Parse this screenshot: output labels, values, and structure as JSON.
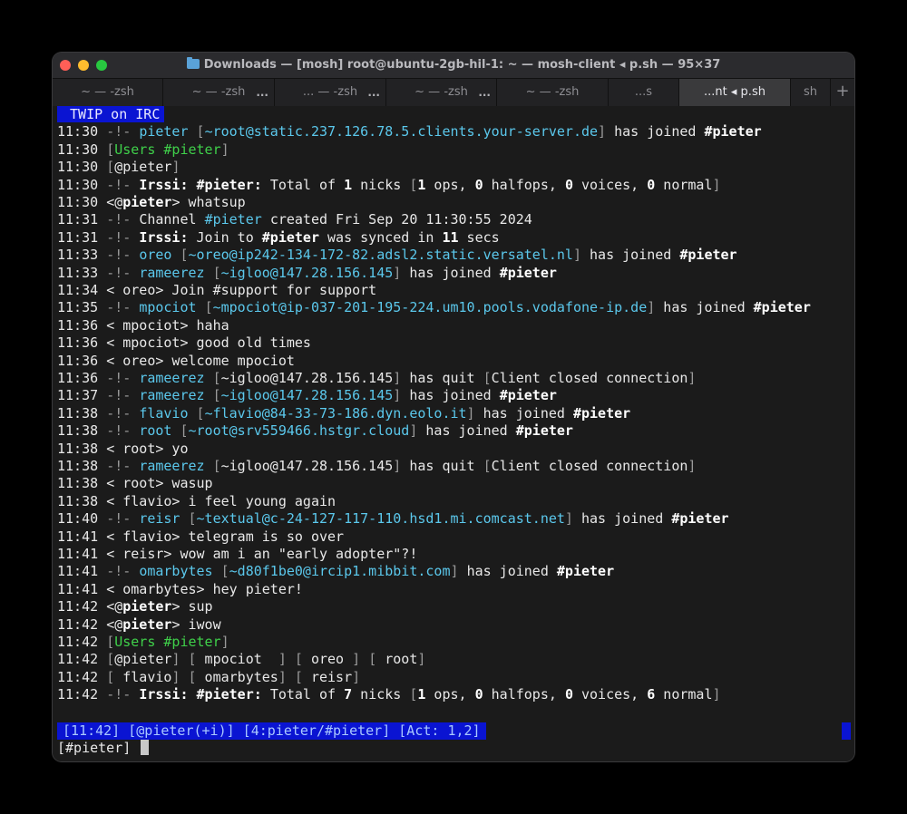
{
  "window": {
    "title": "Downloads — [mosh] root@ubuntu-2gb-hil-1: ~ — mosh-client ◂ p.sh — 95×37",
    "tabs": [
      {
        "label": "~ — -zsh"
      },
      {
        "label": "~ — -zsh"
      },
      {
        "label": "... — -zsh"
      },
      {
        "label": "~ — -zsh"
      },
      {
        "label": "~ — -zsh"
      },
      {
        "label": "...s"
      },
      {
        "label": "...nt ◂ p.sh"
      },
      {
        "label": "sh"
      }
    ],
    "tab_overflow": "...",
    "new_tab": "+"
  },
  "terminal": {
    "header": " TWIP on IRC",
    "lines": [
      [
        [
          "11:30 ",
          "t"
        ],
        [
          "-!- ",
          "d"
        ],
        [
          "pieter ",
          "c"
        ],
        [
          "[",
          "d"
        ],
        [
          "~root@static.237.126.78.5.clients.your-server.de",
          "c"
        ],
        [
          "] ",
          "d"
        ],
        [
          "has joined ",
          "t"
        ],
        [
          "#pieter",
          "b"
        ]
      ],
      [
        [
          "11:30 ",
          "t"
        ],
        [
          "[",
          "d"
        ],
        [
          "Users ",
          "g"
        ],
        [
          "#pieter",
          "g"
        ],
        [
          "]",
          "d"
        ]
      ],
      [
        [
          "11:30 ",
          "t"
        ],
        [
          "[",
          "d"
        ],
        [
          "@pieter",
          "t"
        ],
        [
          "]",
          "d"
        ]
      ],
      [
        [
          "11:30 ",
          "t"
        ],
        [
          "-!- ",
          "d"
        ],
        [
          "Irssi: ",
          "b"
        ],
        [
          "#pieter: ",
          "b"
        ],
        [
          "Total of ",
          "t"
        ],
        [
          "1",
          "b"
        ],
        [
          " nicks ",
          "t"
        ],
        [
          "[",
          "d"
        ],
        [
          "1",
          "b"
        ],
        [
          " ops, ",
          "t"
        ],
        [
          "0",
          "b"
        ],
        [
          " halfops, ",
          "t"
        ],
        [
          "0",
          "b"
        ],
        [
          " voices, ",
          "t"
        ],
        [
          "0",
          "b"
        ],
        [
          " normal",
          "t"
        ],
        [
          "]",
          "d"
        ]
      ],
      [
        [
          "11:30 ",
          "t"
        ],
        [
          "<@",
          "t"
        ],
        [
          "pieter",
          "b"
        ],
        [
          "> whatsup",
          "t"
        ]
      ],
      [
        [
          "11:31 ",
          "t"
        ],
        [
          "-!- ",
          "d"
        ],
        [
          "Channel ",
          "t"
        ],
        [
          "#pieter ",
          "c"
        ],
        [
          "created Fri Sep 20 11:30:55 2024",
          "t"
        ]
      ],
      [
        [
          "11:31 ",
          "t"
        ],
        [
          "-!- ",
          "d"
        ],
        [
          "Irssi: ",
          "b"
        ],
        [
          "Join to ",
          "t"
        ],
        [
          "#pieter ",
          "b"
        ],
        [
          "was synced in ",
          "t"
        ],
        [
          "11",
          "b"
        ],
        [
          " secs",
          "t"
        ]
      ],
      [
        [
          "11:33 ",
          "t"
        ],
        [
          "-!- ",
          "d"
        ],
        [
          "oreo ",
          "c"
        ],
        [
          "[",
          "d"
        ],
        [
          "~oreo@ip242-134-172-82.adsl2.static.versatel.nl",
          "c"
        ],
        [
          "] ",
          "d"
        ],
        [
          "has joined ",
          "t"
        ],
        [
          "#pieter",
          "b"
        ]
      ],
      [
        [
          "11:33 ",
          "t"
        ],
        [
          "-!- ",
          "d"
        ],
        [
          "rameerez ",
          "c"
        ],
        [
          "[",
          "d"
        ],
        [
          "~igloo@147.28.156.145",
          "c"
        ],
        [
          "] ",
          "d"
        ],
        [
          "has joined ",
          "t"
        ],
        [
          "#pieter",
          "b"
        ]
      ],
      [
        [
          "11:34 ",
          "t"
        ],
        [
          "< oreo> Join #support for support",
          "t"
        ]
      ],
      [
        [
          "11:35 ",
          "t"
        ],
        [
          "-!- ",
          "d"
        ],
        [
          "mpociot ",
          "c"
        ],
        [
          "[",
          "d"
        ],
        [
          "~mpociot@ip-037-201-195-224.um10.pools.vodafone-ip.de",
          "c"
        ],
        [
          "] ",
          "d"
        ],
        [
          "has joined ",
          "t"
        ],
        [
          "#pieter",
          "b"
        ]
      ],
      [
        [
          "11:36 ",
          "t"
        ],
        [
          "< mpociot> haha",
          "t"
        ]
      ],
      [
        [
          "11:36 ",
          "t"
        ],
        [
          "< mpociot> good old times",
          "t"
        ]
      ],
      [
        [
          "11:36 ",
          "t"
        ],
        [
          "< oreo> welcome mpociot",
          "t"
        ]
      ],
      [
        [
          "11:36 ",
          "t"
        ],
        [
          "-!- ",
          "d"
        ],
        [
          "rameerez ",
          "c"
        ],
        [
          "[",
          "d"
        ],
        [
          "~igloo@147.28.156.145",
          "t"
        ],
        [
          "] ",
          "d"
        ],
        [
          "has quit ",
          "t"
        ],
        [
          "[",
          "d"
        ],
        [
          "Client closed connection",
          "t"
        ],
        [
          "]",
          "d"
        ]
      ],
      [
        [
          "11:37 ",
          "t"
        ],
        [
          "-!- ",
          "d"
        ],
        [
          "rameerez ",
          "c"
        ],
        [
          "[",
          "d"
        ],
        [
          "~igloo@147.28.156.145",
          "c"
        ],
        [
          "] ",
          "d"
        ],
        [
          "has joined ",
          "t"
        ],
        [
          "#pieter",
          "b"
        ]
      ],
      [
        [
          "11:38 ",
          "t"
        ],
        [
          "-!- ",
          "d"
        ],
        [
          "flavio ",
          "c"
        ],
        [
          "[",
          "d"
        ],
        [
          "~flavio@84-33-73-186.dyn.eolo.it",
          "c"
        ],
        [
          "] ",
          "d"
        ],
        [
          "has joined ",
          "t"
        ],
        [
          "#pieter",
          "b"
        ]
      ],
      [
        [
          "11:38 ",
          "t"
        ],
        [
          "-!- ",
          "d"
        ],
        [
          "root ",
          "c"
        ],
        [
          "[",
          "d"
        ],
        [
          "~root@srv559466.hstgr.cloud",
          "c"
        ],
        [
          "] ",
          "d"
        ],
        [
          "has joined ",
          "t"
        ],
        [
          "#pieter",
          "b"
        ]
      ],
      [
        [
          "11:38 ",
          "t"
        ],
        [
          "< root> yo",
          "t"
        ]
      ],
      [
        [
          "11:38 ",
          "t"
        ],
        [
          "-!- ",
          "d"
        ],
        [
          "rameerez ",
          "c"
        ],
        [
          "[",
          "d"
        ],
        [
          "~igloo@147.28.156.145",
          "t"
        ],
        [
          "] ",
          "d"
        ],
        [
          "has quit ",
          "t"
        ],
        [
          "[",
          "d"
        ],
        [
          "Client closed connection",
          "t"
        ],
        [
          "]",
          "d"
        ]
      ],
      [
        [
          "11:38 ",
          "t"
        ],
        [
          "< root> wasup",
          "t"
        ]
      ],
      [
        [
          "11:38 ",
          "t"
        ],
        [
          "< flavio> i feel young again",
          "t"
        ]
      ],
      [
        [
          "11:40 ",
          "t"
        ],
        [
          "-!- ",
          "d"
        ],
        [
          "reisr ",
          "c"
        ],
        [
          "[",
          "d"
        ],
        [
          "~textual@c-24-127-117-110.hsd1.mi.comcast.net",
          "c"
        ],
        [
          "] ",
          "d"
        ],
        [
          "has joined ",
          "t"
        ],
        [
          "#pieter",
          "b"
        ]
      ],
      [
        [
          "11:41 ",
          "t"
        ],
        [
          "< flavio> telegram is so over",
          "t"
        ]
      ],
      [
        [
          "11:41 ",
          "t"
        ],
        [
          "< reisr> wow am i an \"early adopter\"?!",
          "t"
        ]
      ],
      [
        [
          "11:41 ",
          "t"
        ],
        [
          "-!- ",
          "d"
        ],
        [
          "omarbytes ",
          "c"
        ],
        [
          "[",
          "d"
        ],
        [
          "~d80f1be0@ircip1.mibbit.com",
          "c"
        ],
        [
          "] ",
          "d"
        ],
        [
          "has joined ",
          "t"
        ],
        [
          "#pieter",
          "b"
        ]
      ],
      [
        [
          "11:41 ",
          "t"
        ],
        [
          "< omarbytes> hey pieter!",
          "t"
        ]
      ],
      [
        [
          "11:42 ",
          "t"
        ],
        [
          "<@",
          "t"
        ],
        [
          "pieter",
          "b"
        ],
        [
          "> sup",
          "t"
        ]
      ],
      [
        [
          "11:42 ",
          "t"
        ],
        [
          "<@",
          "t"
        ],
        [
          "pieter",
          "b"
        ],
        [
          "> iwow",
          "t"
        ]
      ],
      [
        [
          "11:42 ",
          "t"
        ],
        [
          "[",
          "d"
        ],
        [
          "Users ",
          "g"
        ],
        [
          "#pieter",
          "g"
        ],
        [
          "]",
          "d"
        ]
      ],
      [
        [
          "11:42 ",
          "t"
        ],
        [
          "[",
          "d"
        ],
        [
          "@pieter",
          "t"
        ],
        [
          "] ",
          "d"
        ],
        [
          "[",
          "d"
        ],
        [
          " mpociot  ",
          "t"
        ],
        [
          "] ",
          "d"
        ],
        [
          "[",
          "d"
        ],
        [
          " oreo ",
          "t"
        ],
        [
          "] ",
          "d"
        ],
        [
          "[",
          "d"
        ],
        [
          " root",
          "t"
        ],
        [
          "]",
          "d"
        ]
      ],
      [
        [
          "11:42 ",
          "t"
        ],
        [
          "[",
          "d"
        ],
        [
          " flavio",
          "t"
        ],
        [
          "] ",
          "d"
        ],
        [
          "[",
          "d"
        ],
        [
          " omarbytes",
          "t"
        ],
        [
          "] ",
          "d"
        ],
        [
          "[",
          "d"
        ],
        [
          " reisr",
          "t"
        ],
        [
          "]",
          "d"
        ]
      ],
      [
        [
          "11:42 ",
          "t"
        ],
        [
          "-!- ",
          "d"
        ],
        [
          "Irssi: ",
          "b"
        ],
        [
          "#pieter: ",
          "b"
        ],
        [
          "Total of ",
          "t"
        ],
        [
          "7",
          "b"
        ],
        [
          " nicks ",
          "t"
        ],
        [
          "[",
          "d"
        ],
        [
          "1",
          "b"
        ],
        [
          " ops, ",
          "t"
        ],
        [
          "0",
          "b"
        ],
        [
          " halfops, ",
          "t"
        ],
        [
          "0",
          "b"
        ],
        [
          " voices, ",
          "t"
        ],
        [
          "6",
          "b"
        ],
        [
          " normal",
          "t"
        ],
        [
          "]",
          "d"
        ]
      ]
    ],
    "statusbar": "[11:42] [@pieter(+i)] [4:pieter/#pieter] [Act: 1,2]",
    "prompt": "[#pieter] "
  },
  "colors": {
    "statusbar_bg": "#0a14d2",
    "cyan": "#5bc8ec",
    "green": "#3fd04a"
  }
}
